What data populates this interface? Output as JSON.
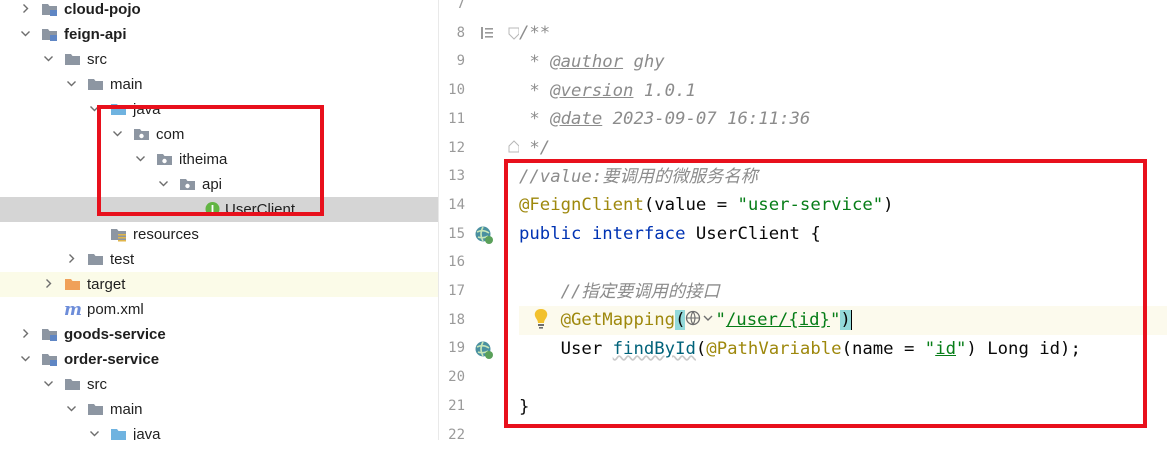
{
  "project_tree": {
    "items": [
      {
        "label": "cloud-pojo",
        "indent": 0,
        "icon": "module-folder-icon",
        "arrow": "collapsed",
        "bold": true
      },
      {
        "label": "feign-api",
        "indent": 0,
        "icon": "module-folder-icon",
        "arrow": "expanded",
        "bold": true
      },
      {
        "label": "src",
        "indent": 1,
        "icon": "folder-icon",
        "arrow": "expanded",
        "bold": false
      },
      {
        "label": "main",
        "indent": 2,
        "icon": "folder-icon",
        "arrow": "expanded",
        "bold": false
      },
      {
        "label": "java",
        "indent": 3,
        "icon": "source-folder-icon",
        "arrow": "expanded",
        "bold": false
      },
      {
        "label": "com",
        "indent": 4,
        "icon": "package-icon",
        "arrow": "expanded",
        "bold": false
      },
      {
        "label": "itheima",
        "indent": 5,
        "icon": "package-icon",
        "arrow": "expanded",
        "bold": false
      },
      {
        "label": "api",
        "indent": 6,
        "icon": "package-icon",
        "arrow": "expanded",
        "bold": false
      },
      {
        "label": "UserClient",
        "indent": 7,
        "icon": "interface-icon",
        "arrow": "none",
        "bold": false,
        "selected": true
      },
      {
        "label": "resources",
        "indent": 3,
        "icon": "resources-folder-icon",
        "arrow": "none",
        "bold": false
      },
      {
        "label": "test",
        "indent": 2,
        "icon": "folder-icon",
        "arrow": "collapsed",
        "bold": false
      },
      {
        "label": "target",
        "indent": 1,
        "icon": "target-folder-icon",
        "arrow": "collapsed",
        "bold": false,
        "highlighted": true
      },
      {
        "label": "pom.xml",
        "indent": 1,
        "icon": "maven-icon",
        "arrow": "none",
        "bold": false
      },
      {
        "label": "goods-service",
        "indent": 0,
        "icon": "module-folder-icon",
        "arrow": "collapsed",
        "bold": true
      },
      {
        "label": "order-service",
        "indent": 0,
        "icon": "module-folder-icon",
        "arrow": "expanded",
        "bold": true
      },
      {
        "label": "src",
        "indent": 1,
        "icon": "folder-icon",
        "arrow": "expanded",
        "bold": false
      },
      {
        "label": "main",
        "indent": 2,
        "icon": "folder-icon",
        "arrow": "expanded",
        "bold": false
      },
      {
        "label": "java",
        "indent": 3,
        "icon": "source-folder-icon",
        "arrow": "expanded",
        "bold": false
      }
    ]
  },
  "editor": {
    "line_numbers": [
      "7",
      "8",
      "9",
      "10",
      "11",
      "12",
      "13",
      "14",
      "15",
      "16",
      "17",
      "18",
      "19",
      "20",
      "21",
      "22"
    ],
    "current_line": "18",
    "code": {
      "l8_open": "/**",
      "l9_star": " * ",
      "l9_tag": "@author",
      "l9_val": " ghy",
      "l10_star": " * ",
      "l10_tag": "@version",
      "l10_val": " 1.0.1",
      "l11_star": " * ",
      "l11_tag": "@date",
      "l11_val": " 2023-09-07 16:11:36",
      "l12_close": " */",
      "l13_comment": "//value:要调用的微服务名称",
      "l14_ann": "@FeignClient",
      "l14_a": "(value = ",
      "l14_str": "\"user-service\"",
      "l14_b": ")",
      "l15_kw1": "public",
      "l15_sp": " ",
      "l15_kw2": "interface",
      "l15_rest": " UserClient {",
      "l17_indent": "    ",
      "l17_comment": "//指定要调用的接口",
      "l18_indent": "    ",
      "l18_ann": "@GetMapping",
      "l18_open": "(",
      "l18_q1": "\"",
      "l18_path": "/user/{id}",
      "l18_q2": "\"",
      "l18_close": ")",
      "l19_indent": "    ",
      "l19_type": "User ",
      "l19_fn": "findById",
      "l19_a": "(",
      "l19_ann": "@PathVariable",
      "l19_b": "(name = ",
      "l19_q1": "\"",
      "l19_id": "id",
      "l19_q2": "\"",
      "l19_c": ") Long id);",
      "l21_brace": "}"
    }
  },
  "colors": {
    "highlight_box": "#e8101c",
    "keyword": "#0033b3",
    "annotation": "#9e880d",
    "string": "#067d17",
    "comment": "#8c8c8c"
  }
}
